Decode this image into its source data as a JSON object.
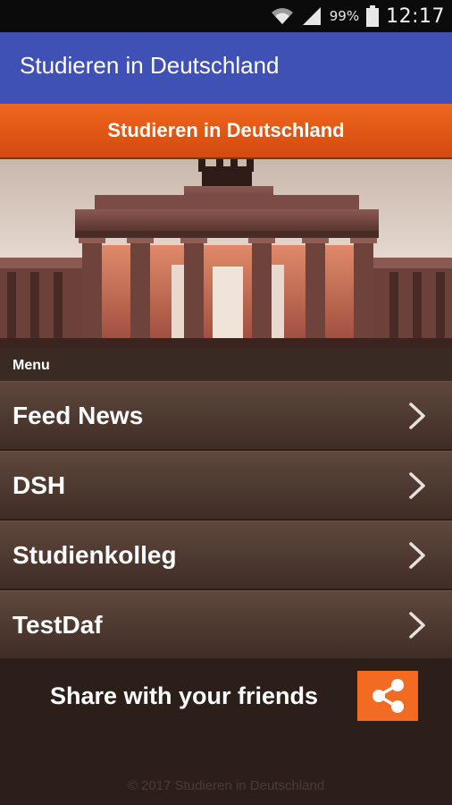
{
  "status_bar": {
    "battery": "99%",
    "time": "12:17"
  },
  "app_bar": {
    "title": "Studieren in Deutschland"
  },
  "banner": {
    "title": "Studieren in Deutschland"
  },
  "menu": {
    "header": "Menu",
    "items": [
      {
        "label": "Feed News"
      },
      {
        "label": "DSH"
      },
      {
        "label": "Studienkolleg"
      },
      {
        "label": "TestDaf"
      }
    ]
  },
  "share": {
    "label": "Share with your friends"
  },
  "footer": {
    "copyright": "© 2017 Studieren in Deutschland"
  },
  "colors": {
    "app_bar": "#3f51b5",
    "banner": "#e85a16",
    "share_button": "#f36a22",
    "background": "#2c1f1a"
  },
  "icons": {
    "wifi": "wifi-icon",
    "signal": "signal-icon",
    "battery": "battery-icon",
    "chevron": "chevron-right-icon",
    "share": "share-icon"
  }
}
